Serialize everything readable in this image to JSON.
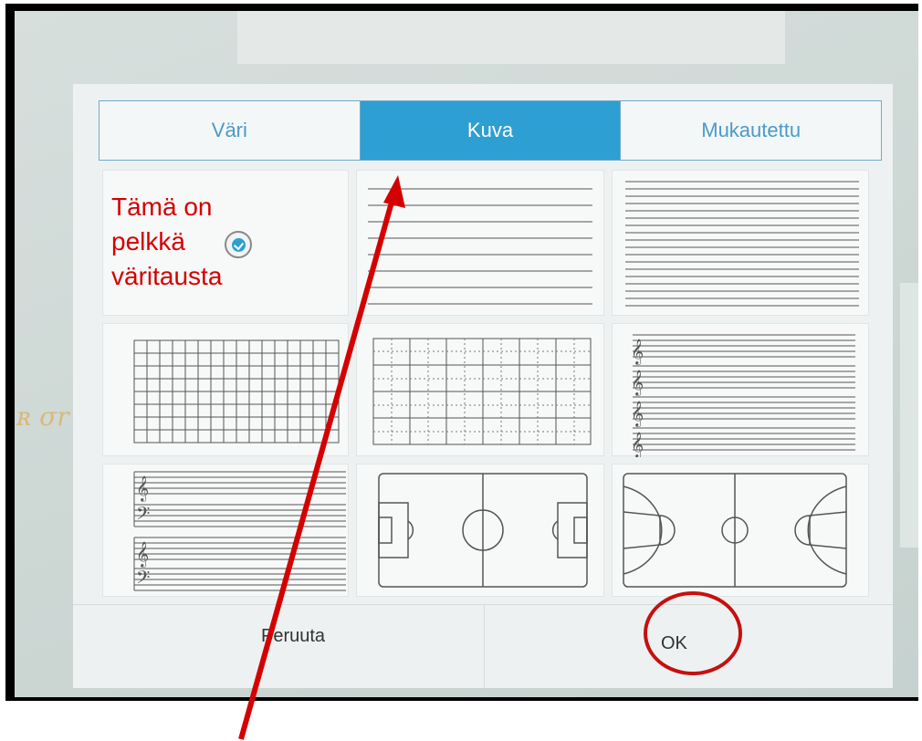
{
  "tabs": [
    {
      "label": "Väri",
      "active": false
    },
    {
      "label": "Kuva",
      "active": true
    },
    {
      "label": "Mukautettu",
      "active": false
    }
  ],
  "annotation": {
    "line1": "Tämä on",
    "line2": "pelkkä",
    "line3": "väritausta"
  },
  "templates": [
    "solid-color-background",
    "wide-ruled-lines",
    "narrow-ruled-lines",
    "square-grid",
    "dotted-grid",
    "treble-staff",
    "grand-staff",
    "soccer-field",
    "basketball-court"
  ],
  "buttons": {
    "cancel": "Peruuta",
    "ok": "OK"
  },
  "colors": {
    "accent": "#2d9fd2",
    "annotation": "#d40000"
  }
}
